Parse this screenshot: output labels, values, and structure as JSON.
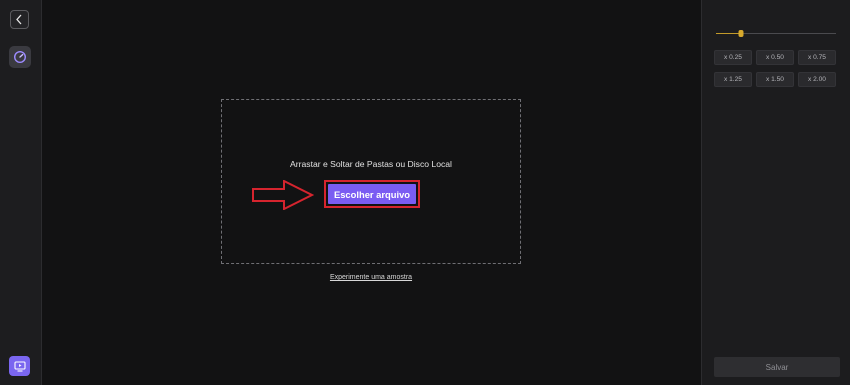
{
  "sidebar": {
    "back_icon": "chevron-left-icon",
    "speed_icon": "speedometer-icon",
    "media_icon": "media-screen-icon",
    "accent_color": "#7a66f0"
  },
  "upload": {
    "instruction": "Arrastar e Soltar de Pastas ou Disco Local",
    "choose_file_label": "Escolher arquivo",
    "sample_link": "Experimente uma amostra",
    "highlight_color": "#d6242e"
  },
  "speed_panel": {
    "slider_value_percent": 21,
    "slider_color": "#d7a92c",
    "options": [
      "x 0.25",
      "x 0.50",
      "x 0.75",
      "x 1.25",
      "x 1.50",
      "x 2.00"
    ],
    "save_label": "Salvar"
  }
}
